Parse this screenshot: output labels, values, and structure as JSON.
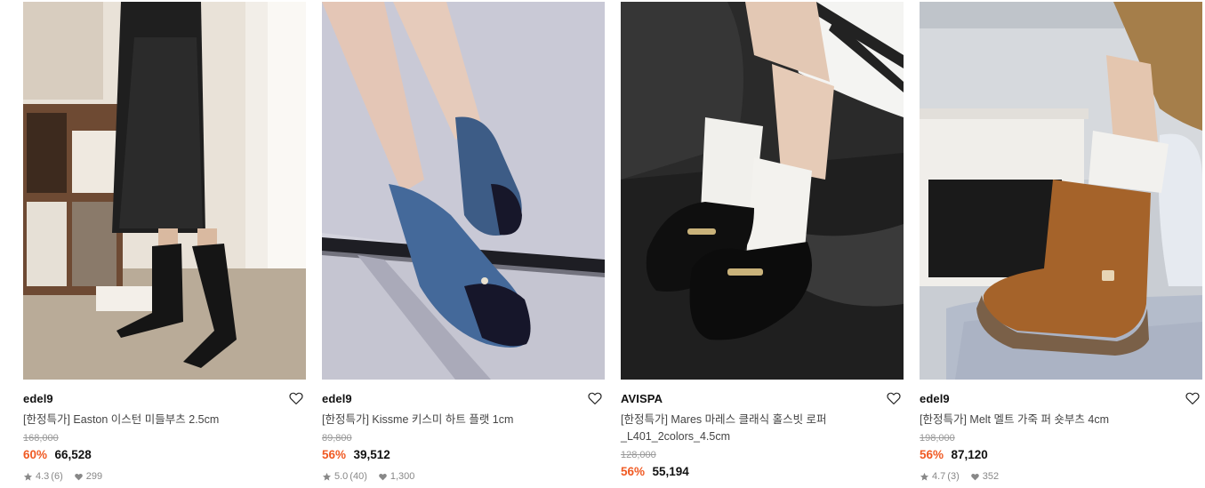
{
  "products": [
    {
      "brand": "edel9",
      "title": "[한정특가] Easton 이스턴 미들부츠 2.5cm",
      "original_price": "168,000",
      "discount": "60%",
      "price": "66,528",
      "rating": "4.3",
      "review_count": "(6)",
      "likes": "299",
      "image_icon": "product-photo-black-leather-boots"
    },
    {
      "brand": "edel9",
      "title": "[한정특가] Kissme 키스미 하트 플랫 1cm",
      "original_price": "89,800",
      "discount": "56%",
      "price": "39,512",
      "rating": "5.0",
      "review_count": "(40)",
      "likes": "1,300",
      "image_icon": "product-photo-denim-ballet-flats"
    },
    {
      "brand": "AVISPA",
      "title": "[한정특가] Mares 마레스 클래식 홀스빗 로퍼 _L401_2colors_4.5cm",
      "original_price": "128,000",
      "discount": "56%",
      "price": "55,194",
      "rating": "",
      "review_count": "",
      "likes": "",
      "image_icon": "product-photo-black-horsebit-loafers"
    },
    {
      "brand": "edel9",
      "title": "[한정특가] Melt 멜트 가죽 퍼 숏부츠 4cm",
      "original_price": "198,000",
      "discount": "56%",
      "price": "87,120",
      "rating": "4.7",
      "review_count": "(3)",
      "likes": "352",
      "image_icon": "product-photo-suede-short-boots"
    }
  ],
  "icons": {
    "wishlist": "heart-outline-icon",
    "rating": "star-icon",
    "likes": "heart-filled-icon"
  },
  "colors": {
    "discount": "#f05a23",
    "brand": "#111111",
    "muted": "#888888"
  }
}
